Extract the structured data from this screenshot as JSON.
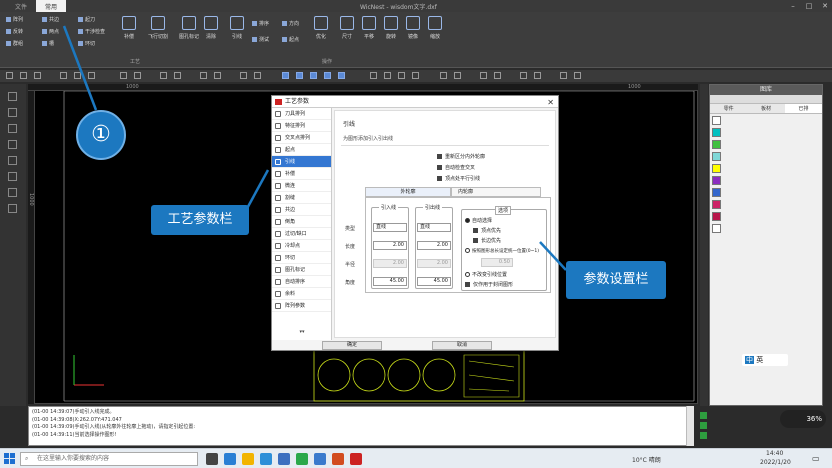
{
  "window": {
    "title": "WicNest - wisdom文字.dxf",
    "tabs": [
      "文件",
      "常用",
      "",
      "",
      "",
      ""
    ],
    "min": "–",
    "max": "□",
    "close": "✕"
  },
  "ribbon": {
    "small_items": [
      "阵列",
      "反转",
      "群组",
      "共边",
      "两点",
      "槽",
      "起刀",
      "干涉检查",
      "环切",
      "方向",
      "起点",
      "排序",
      "测试"
    ],
    "big_buttons": [
      "补偿",
      "飞行切割",
      "图孔标记",
      "清除",
      "引线",
      "优化",
      "尺寸",
      "平移",
      "旋转",
      "镜像",
      "缩放"
    ],
    "group_labels": [
      "工艺",
      "操作"
    ]
  },
  "rulers": {
    "top_marks": [
      "1000",
      "1000"
    ],
    "left_mark": "1000"
  },
  "dialog": {
    "title": "工艺参数",
    "close": "✕",
    "nav_items": [
      "刀具排列",
      "特征排列",
      "交叉点排列",
      "起点",
      "引线",
      "补偿",
      "微连",
      "割缝",
      "共边",
      "倒角",
      "过切/缺口",
      "冷却点",
      "环切",
      "图孔标记",
      "自动排序",
      "余料",
      "阵列参数"
    ],
    "nav_more": "▾▾",
    "active_index": 4,
    "section_title": "引线",
    "section_subtitle": "为图形添加引入引出线",
    "checkboxes": [
      "重新区分内外轮廓",
      "自动检查交叉",
      "顶点处平行引线"
    ],
    "outer_tab": "外轮廓",
    "inner_tab": "内轮廓",
    "lead_in_label": "引入线",
    "lead_out_label": "引出线",
    "row_labels": [
      "类型",
      "长度",
      "半径",
      "角度"
    ],
    "lead_in": {
      "type": "直线",
      "length": "2.00",
      "radius": "2.00",
      "angle": "45.00"
    },
    "lead_out": {
      "type": "直线",
      "length": "2.00",
      "radius": "2.00",
      "angle": "45.00"
    },
    "options_label": "选项",
    "auto_select": "自动选择",
    "opt_checks": [
      "顶点优先",
      "长边优先"
    ],
    "radio_cut": "按照图形总长设定统一位置(0~1)",
    "cut_value": "0.50",
    "radio_keep": "不改变引线位置",
    "closed_only": "仅作用于封闭图形",
    "ok": "确定",
    "cancel": "取消"
  },
  "panel": {
    "title": "图库",
    "tabs": [
      "零件",
      "板材",
      "已排"
    ]
  },
  "console": {
    "lines": [
      "(01-00 14:39:07)手动引入线完成。",
      "(01-00 14:39:08)X:262.07Y:471.047",
      "(01-00 14:39:09)手动引入线(从轮廓外往轮廓上拖动)，请指定引起位置:",
      "(01-00 14:39:11)当前选择操作图形!"
    ]
  },
  "taskbar": {
    "search_placeholder": "在这里输入你要搜索的内容",
    "weather": "10°C 晴朗",
    "time": "14:40",
    "date": "2022/1/20",
    "ime": "中",
    "ime_mode": "英",
    "indicator": "36%"
  },
  "annotations": {
    "step_number": "①",
    "left_callout": "工艺参数栏",
    "right_callout": "参数设置栏"
  },
  "colors": {
    "accent": "#1c78c0",
    "swatches": [
      "#ffffff",
      "#00c0c0",
      "#3fbf3f",
      "#7fd7d7",
      "#ffff00",
      "#8b2dbf",
      "#3366cc",
      "#cc2266",
      "#b8154a",
      "#ffffff"
    ]
  }
}
